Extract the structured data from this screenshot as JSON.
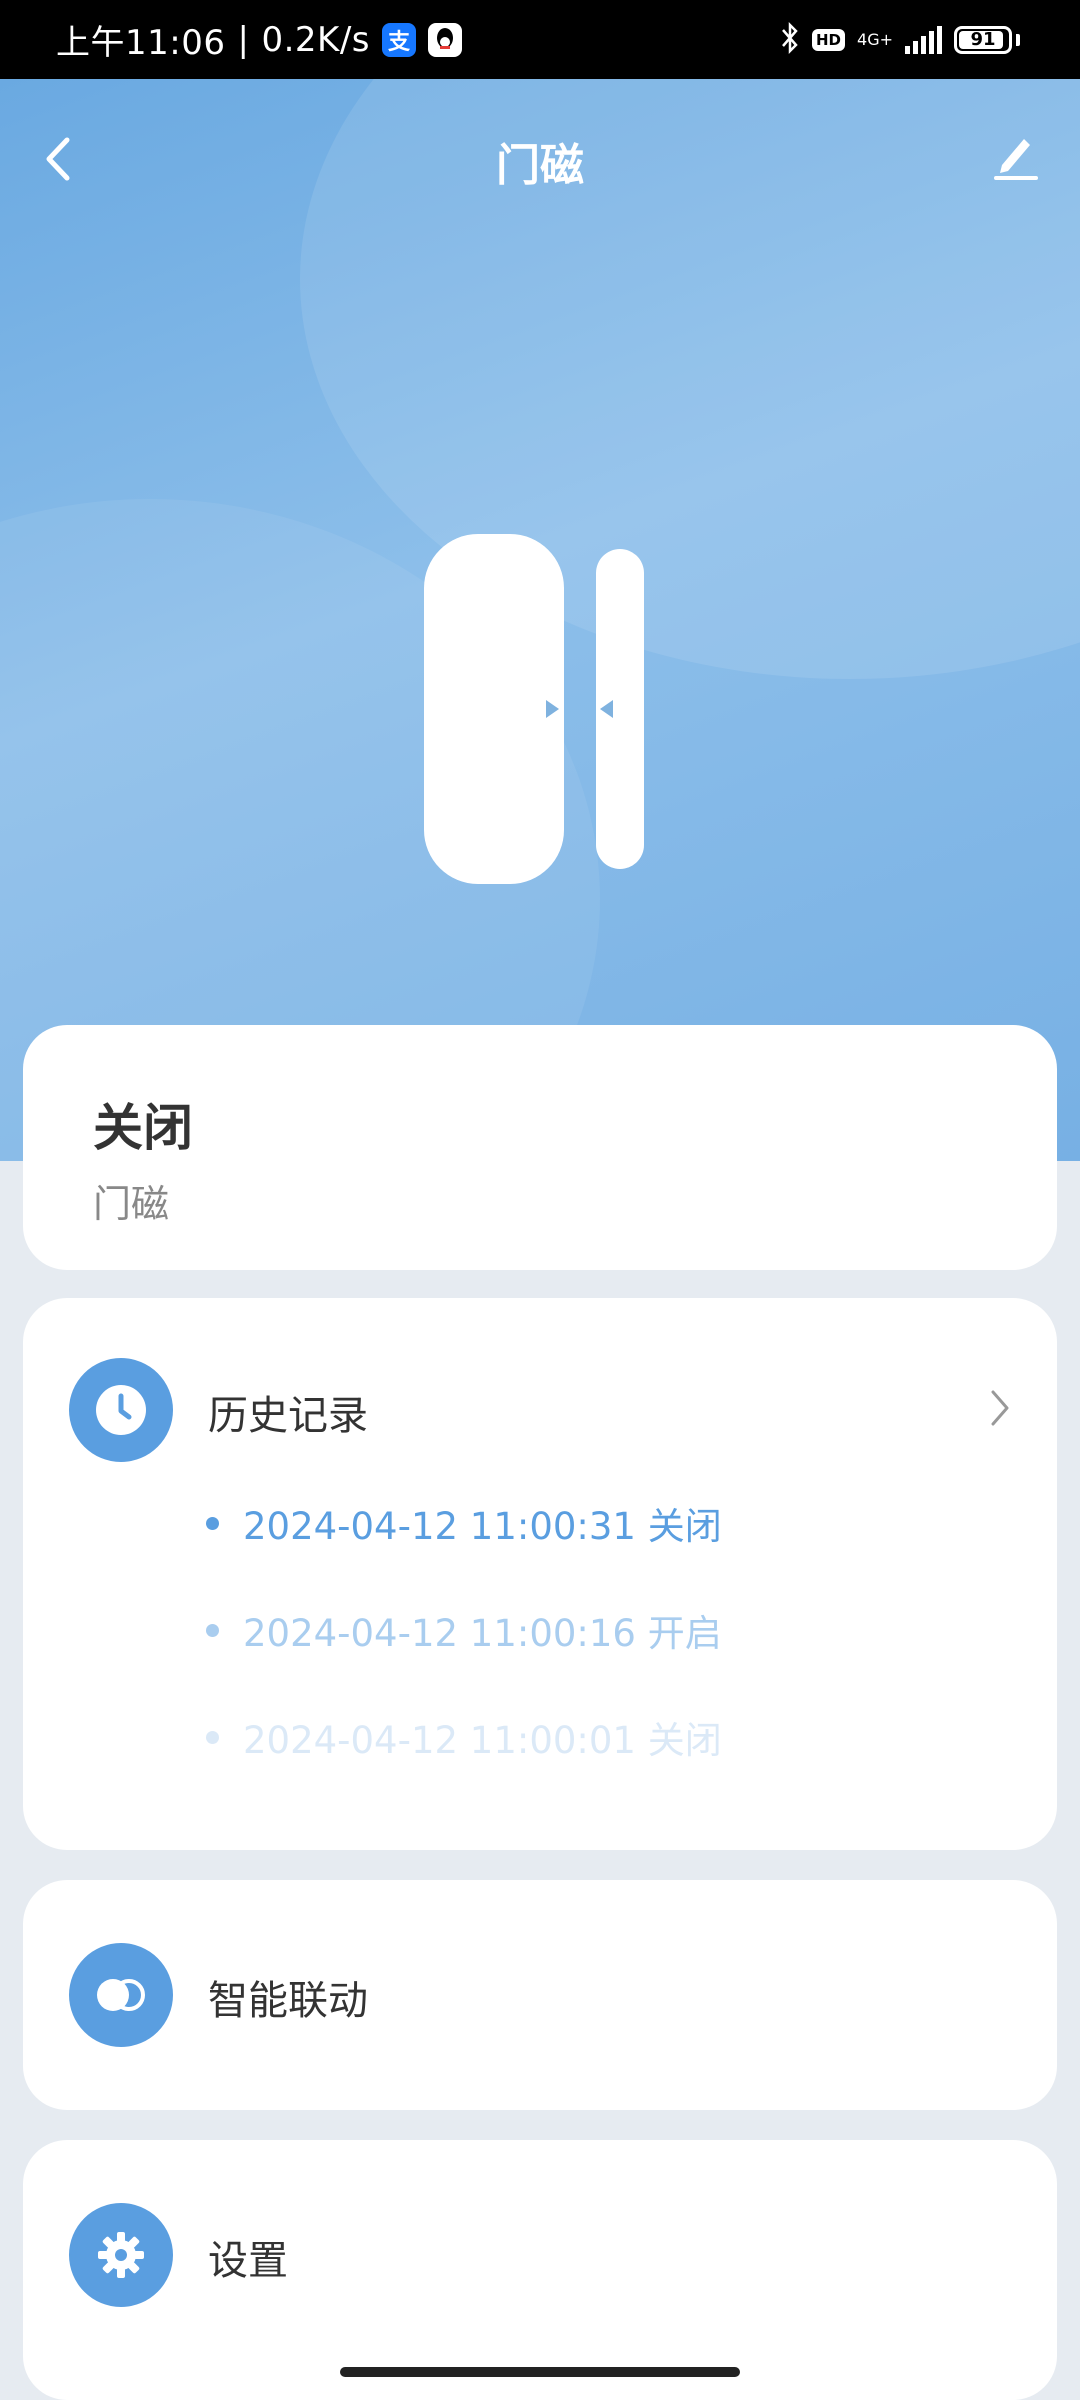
{
  "status_bar": {
    "time": "上午11:06",
    "separator": "|",
    "speed": "0.2K/s",
    "icons": [
      "alipay-icon",
      "qq-icon",
      "bluetooth-icon",
      "hd-icon",
      "signal-icon",
      "battery-icon"
    ],
    "alipay_glyph": "支",
    "hd": "HD",
    "network": "4G+",
    "battery": "91",
    "battery_level": 0.91
  },
  "navbar": {
    "title": "门磁",
    "back_icon": "chevron-left-icon",
    "edit_icon": "pencil-icon"
  },
  "status_card": {
    "state": "关闭",
    "device": "门磁"
  },
  "history": {
    "label": "历史记录",
    "icon": "clock-icon",
    "records": [
      {
        "text": "2024-04-12 11:00:31 关闭"
      },
      {
        "text": "2024-04-12 11:00:16 开启"
      },
      {
        "text": "2024-04-12 11:00:01 关闭"
      }
    ]
  },
  "automation": {
    "label": "智能联动",
    "icon": "toggle-icon"
  },
  "settings": {
    "label": "设置",
    "icon": "gear-icon"
  },
  "colors": {
    "accent": "#5a9ee0",
    "hero_top": "#6aa9e1",
    "hero_light": "#8dbfea",
    "record_active": "#5a9ee0",
    "record_mid": "#a9cdef",
    "record_faded": "#dbe9f7",
    "page_bg": "#e6ebf1"
  }
}
